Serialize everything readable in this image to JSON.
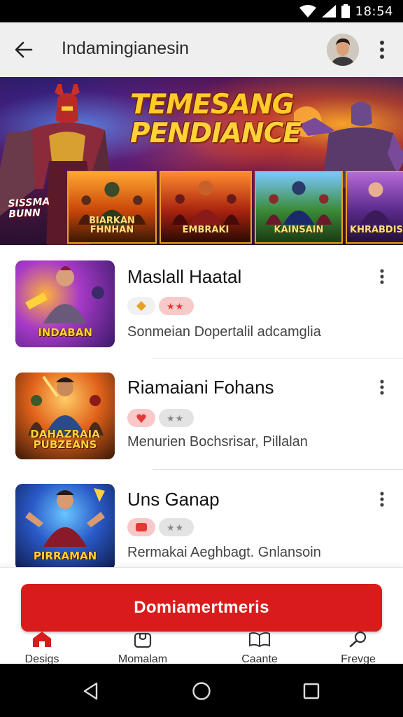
{
  "status_bar": {
    "time": "18:54"
  },
  "app_bar": {
    "title": "Indamingianesin"
  },
  "banner": {
    "title_line1": "TEMESANG",
    "title_line2": "PENDIANCE",
    "left_label": "SISSMA BUNN",
    "cards": [
      "BIARKAN FHNHAN",
      "EMBRAKI",
      "KAINSAIN",
      "KHRABDIS"
    ]
  },
  "games": [
    {
      "title": "Maslall Haatal",
      "thumb_label": "INDABAN",
      "subtitle": "Sonmeian  Dopertalil adcamglia",
      "chip_a_color": "#e8a020",
      "chip_b_color": "#e53935"
    },
    {
      "title": "Riamaiani Fohans",
      "thumb_label": "DAHAZRAIA PUBZEANS",
      "subtitle": "Menurien Bochsrisar, Pillalan",
      "chip_a_color": "#e53935",
      "chip_b_color": "#9e9e9e"
    },
    {
      "title": "Uns Ganap",
      "thumb_label": "PIRRAMAN",
      "subtitle": "Rermakai Aeghbagt. Gnlansoin",
      "chip_a_color": "#e53935",
      "chip_b_color": "#9e9e9e"
    }
  ],
  "cta": {
    "label": "Domiamertmeris"
  },
  "bottom_nav": [
    {
      "label": "Desigs",
      "icon": "home-icon"
    },
    {
      "label": "Momalam",
      "icon": "bag-icon"
    },
    {
      "label": "Caante",
      "icon": "book-icon"
    },
    {
      "label": "Frevge",
      "icon": "search-icon"
    }
  ],
  "colors": {
    "accent": "#d81c1c",
    "app_bar": "#efefef"
  }
}
